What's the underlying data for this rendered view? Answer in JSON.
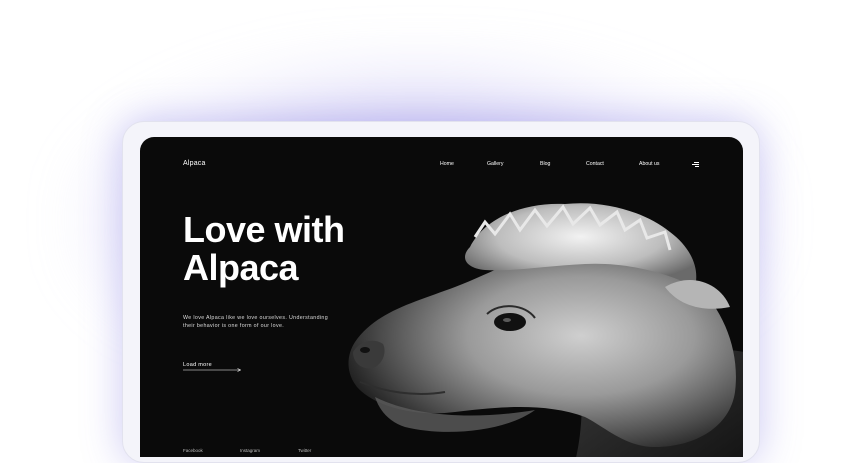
{
  "header": {
    "brand": "Alpaca"
  },
  "nav": {
    "items": [
      "Home",
      "Gallery",
      "Blog",
      "Contact",
      "About us"
    ]
  },
  "hero": {
    "title_line1": "Love with",
    "title_line2": "Alpaca",
    "description": "We love Alpaca like we love ourselves. Understanding their behavior is one form of our love.",
    "cta_label": "Load more"
  },
  "social": {
    "items": [
      "Facebook",
      "Instagram",
      "Twitter"
    ]
  },
  "colors": {
    "background": "#0a0a0a",
    "text": "#ffffff",
    "glow": "#8a7fe0"
  },
  "icons": {
    "menu": "menu-icon",
    "arrow": "arrow-right-icon"
  }
}
